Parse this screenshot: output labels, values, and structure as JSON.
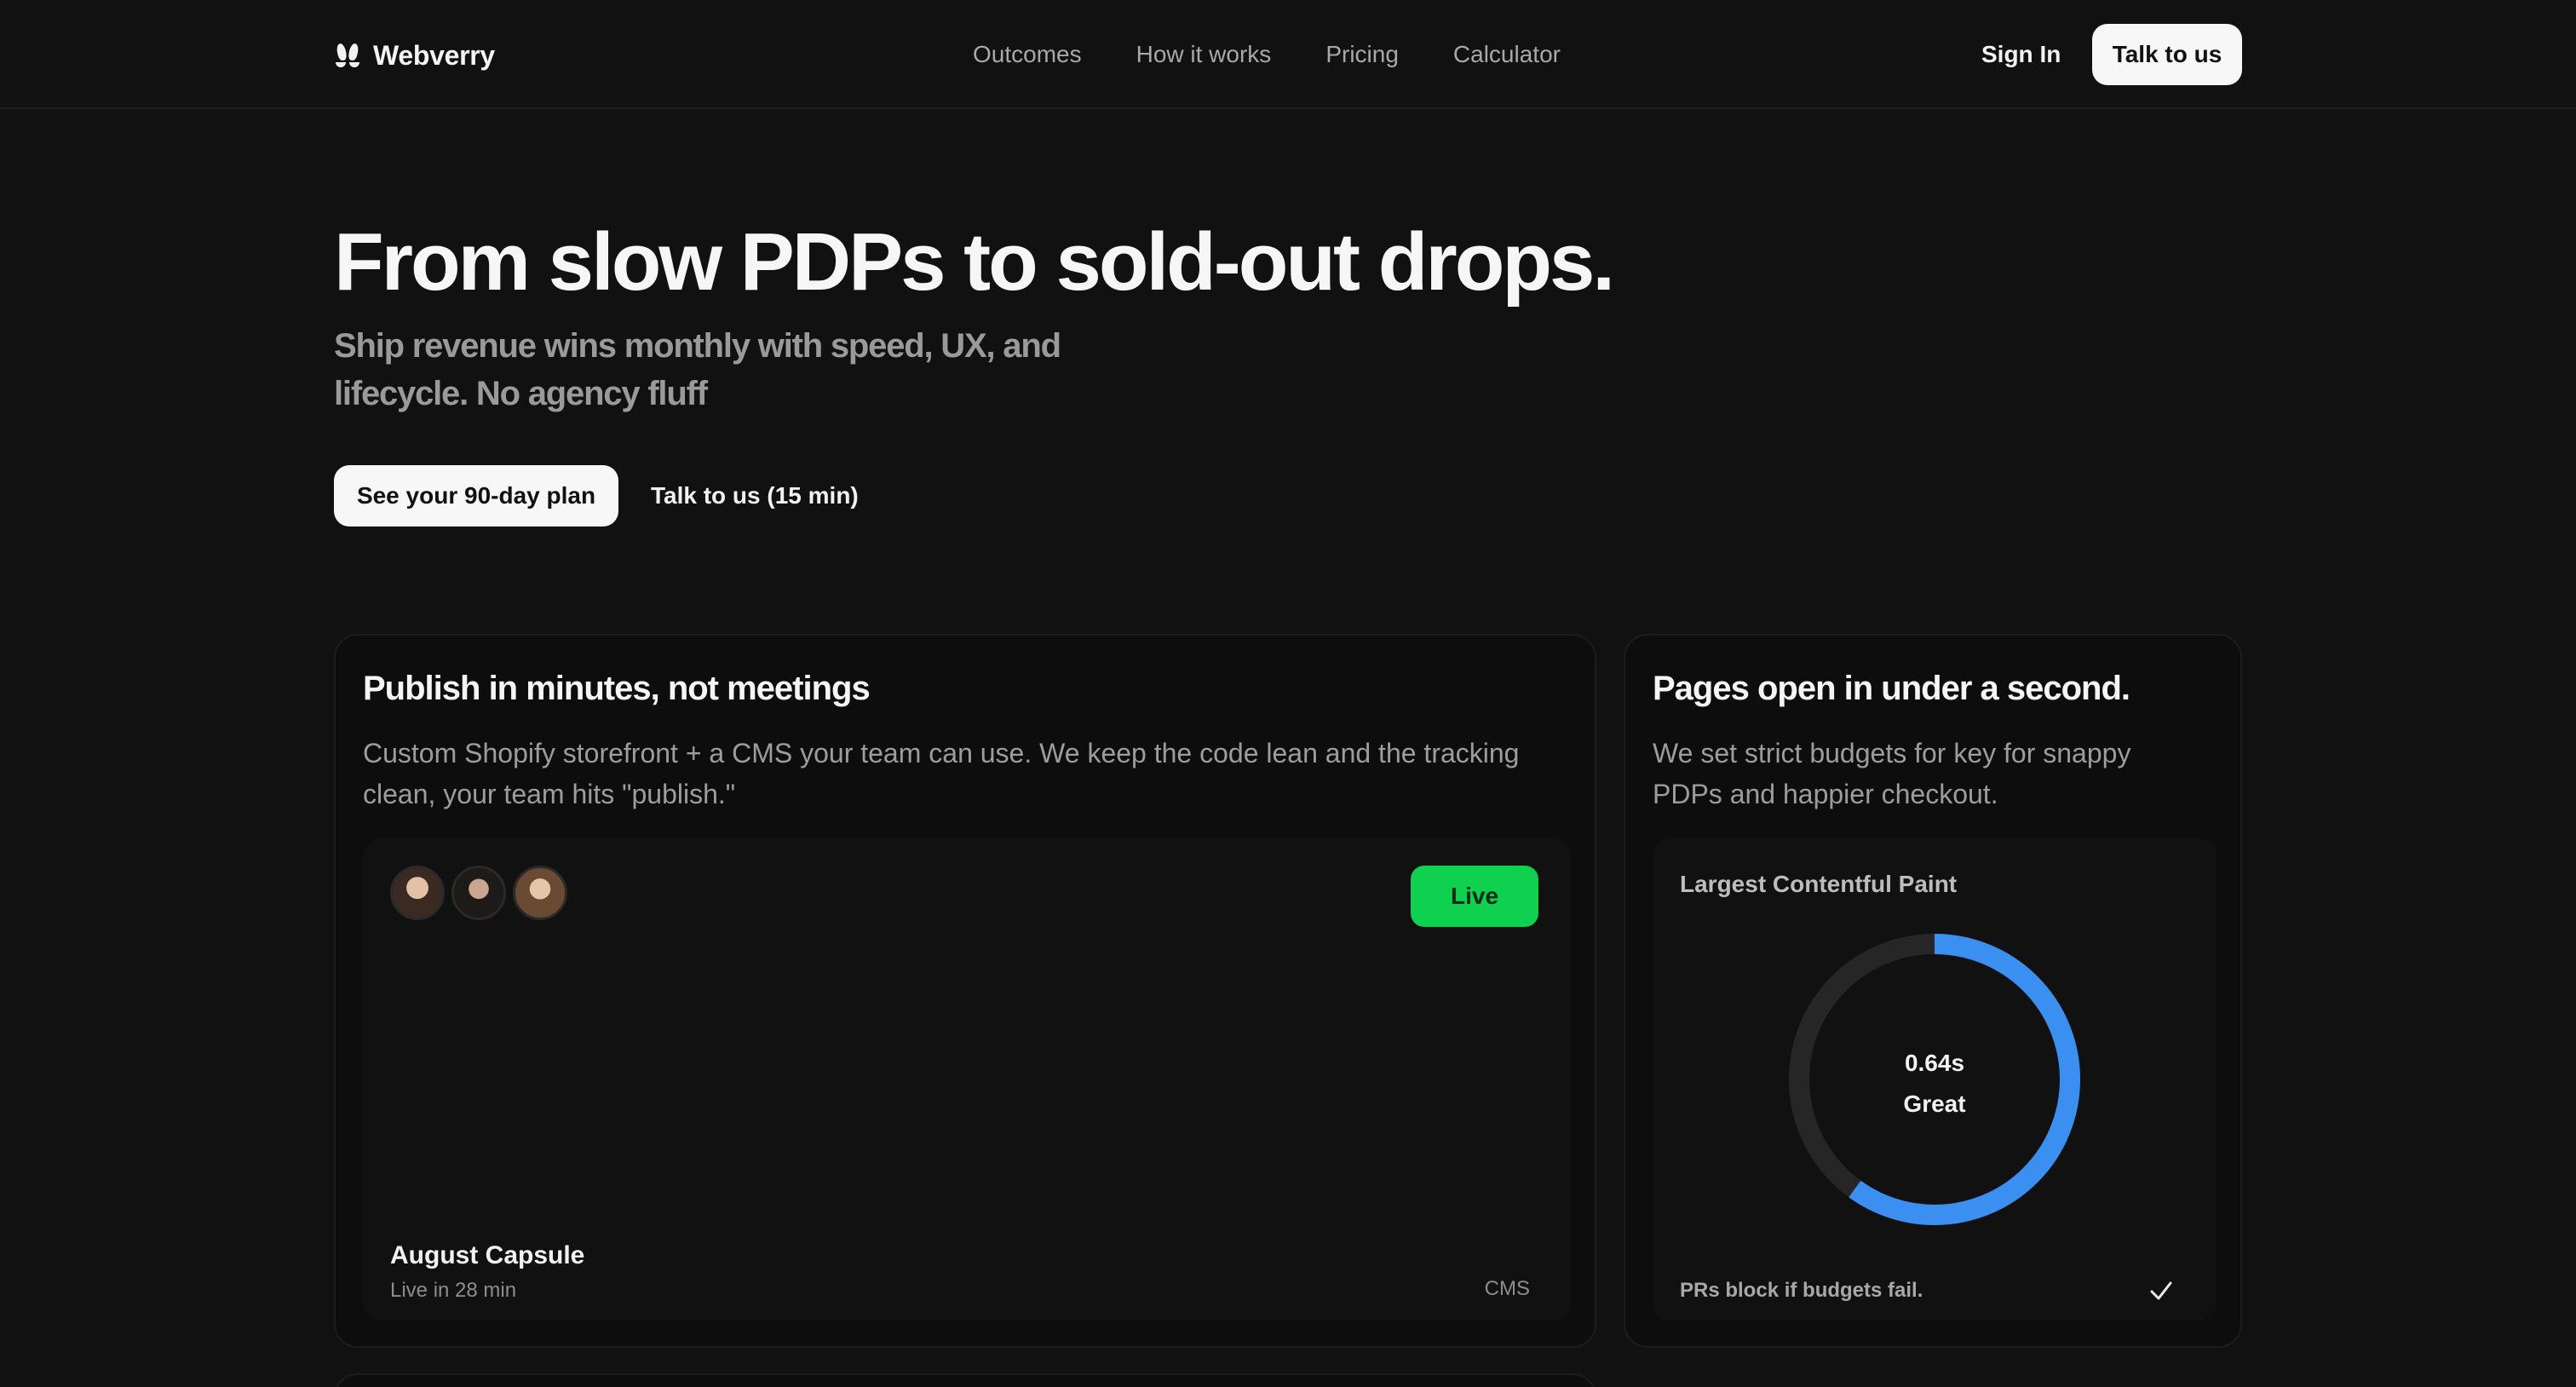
{
  "nav": {
    "brand": "Webverry",
    "links": [
      "Outcomes",
      "How it works",
      "Pricing",
      "Calculator"
    ],
    "sign_in": "Sign In",
    "talk": "Talk to us"
  },
  "hero": {
    "title": "From slow PDPs to sold-out drops.",
    "subtitle": "Ship revenue wins monthly with speed, UX, and lifecycle. No agency fluff",
    "cta_primary": "See your 90-day plan",
    "cta_secondary": "Talk to us (15 min)"
  },
  "card_publish": {
    "title": "Publish in minutes, not meetings",
    "description": "Custom Shopify storefront + a CMS your team can use. We keep the code lean and the tracking clean, your team hits \"publish.\"",
    "status": "Live",
    "item_title": "August Capsule",
    "item_meta": "Live in 28 min",
    "tag": "CMS"
  },
  "card_speed": {
    "title": "Pages open in under a second.",
    "description": "We set strict budgets for key for snappy PDPs and happier checkout.",
    "metric_label": "Largest Contentful Paint",
    "value": "0.64s",
    "rating": "Great",
    "gauge_fraction": 0.6,
    "note": "PRs block if budgets fail."
  },
  "colors": {
    "background": "#111111",
    "card": "#0d0d0d",
    "live_green": "#0fd04f",
    "gauge_blue": "#3a8ff0",
    "gauge_track": "#262626"
  },
  "icons": {
    "brand": "webverry-logo-icon",
    "check": "check-icon"
  }
}
